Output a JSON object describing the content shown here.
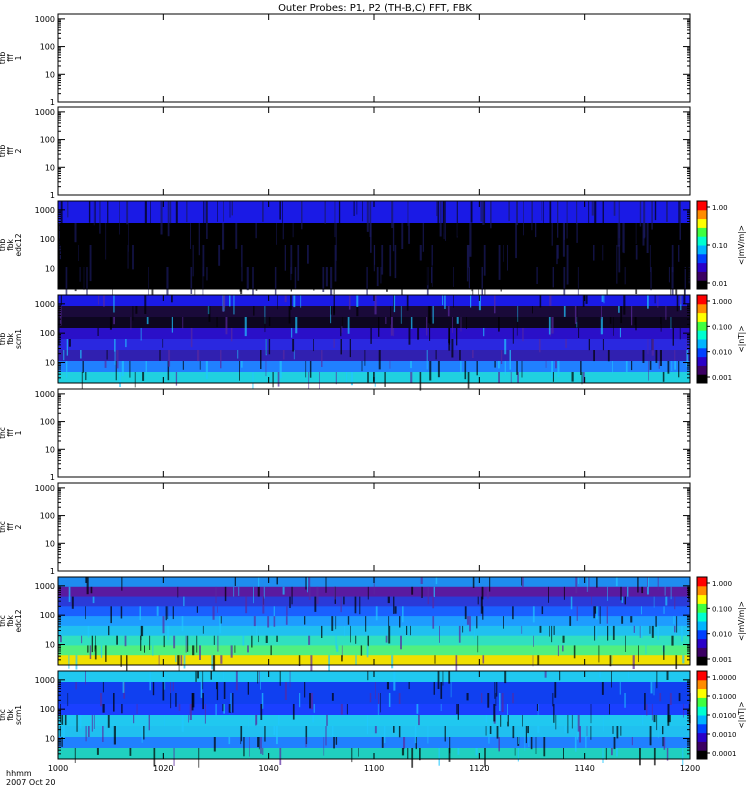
{
  "title": "Outer Probes: P1, P2 (TH-B,C) FFT, FBK",
  "time_axis": {
    "title_line1": "hhmm",
    "title_line2": "2007 Oct 20",
    "ticks": [
      "1000",
      "1020",
      "1040",
      "1100",
      "1120",
      "1140",
      "1200"
    ],
    "range": [
      "10:00",
      "12:00"
    ]
  },
  "colors": {
    "colorbar": [
      "#000000",
      "#3b0063",
      "#2a00c8",
      "#0040ff",
      "#00b4ff",
      "#00ffd0",
      "#40ff40",
      "#ffff00",
      "#ff8c00",
      "#ff0000"
    ]
  },
  "chart_data": [
    {
      "type": "heatmap",
      "ylabel": [
        "thb",
        "fff",
        "1"
      ],
      "y_ticks": [
        "1",
        "10",
        "100",
        "1000"
      ],
      "ylim": [
        1,
        1500
      ],
      "yscale": "log",
      "has_data": false
    },
    {
      "type": "heatmap",
      "ylabel": [
        "thb",
        "fff",
        "2"
      ],
      "y_ticks": [
        "1",
        "10",
        "100",
        "1000"
      ],
      "ylim": [
        1,
        1500
      ],
      "yscale": "log",
      "has_data": false
    },
    {
      "type": "heatmap",
      "ylabel": [
        "thb",
        "fbk",
        "edc12"
      ],
      "y_ticks": [
        "10",
        "100",
        "1000"
      ],
      "ylim": [
        2,
        2000
      ],
      "yscale": "log",
      "has_data": true,
      "bands": [
        "#1a1ae6",
        "#000000",
        "#000000",
        "#000000"
      ],
      "colorbar": {
        "label": "<|mV/m|>",
        "ticks": [
          "1.00",
          "0.10",
          "0.01"
        ]
      }
    },
    {
      "type": "heatmap",
      "ylabel": [
        "thb",
        "fbk",
        "scm1"
      ],
      "y_ticks": [
        "10",
        "100",
        "1000"
      ],
      "ylim": [
        2,
        2000
      ],
      "yscale": "log",
      "has_data": true,
      "bands": [
        "#1a1ae6",
        "#1a0a3a",
        "#0d0620",
        "#2a10c8",
        "#2a28e0",
        "#3020b0",
        "#2080ff",
        "#20d0e0"
      ],
      "colorbar": {
        "label": "<|nT|>",
        "ticks": [
          "1.000",
          "0.100",
          "0.010",
          "0.001"
        ]
      }
    },
    {
      "type": "heatmap",
      "ylabel": [
        "thc",
        "fff",
        "1"
      ],
      "y_ticks": [
        "1",
        "10",
        "100",
        "1000"
      ],
      "ylim": [
        1,
        1500
      ],
      "yscale": "log",
      "has_data": false
    },
    {
      "type": "heatmap",
      "ylabel": [
        "thc",
        "fff",
        "2"
      ],
      "y_ticks": [
        "1",
        "10",
        "100",
        "1000"
      ],
      "ylim": [
        1,
        1500
      ],
      "yscale": "log",
      "has_data": false
    },
    {
      "type": "heatmap",
      "ylabel": [
        "thc",
        "fbk",
        "edc12"
      ],
      "y_ticks": [
        "10",
        "100",
        "1000"
      ],
      "ylim": [
        2,
        2000
      ],
      "yscale": "log",
      "has_data": true,
      "bands": [
        "#1e8cf0",
        "#5a1aa0",
        "#2a3ad8",
        "#1a60ff",
        "#1e9cff",
        "#20c0f0",
        "#30e0c0",
        "#50f080",
        "#f0e000"
      ],
      "colorbar": {
        "label": "<|mV/m|>",
        "ticks": [
          "1.000",
          "0.100",
          "0.010",
          "0.001"
        ]
      }
    },
    {
      "type": "heatmap",
      "ylabel": [
        "thc",
        "fbk",
        "scm1"
      ],
      "y_ticks": [
        "10",
        "100",
        "1000"
      ],
      "ylim": [
        2,
        2000
      ],
      "yscale": "log",
      "has_data": true,
      "bands": [
        "#20c8f0",
        "#1040f0",
        "#1040f0",
        "#1a40ff",
        "#20c8f0",
        "#20c0f0",
        "#2080ff",
        "#20d0c0"
      ],
      "colorbar": {
        "label": "<|nT|>",
        "ticks": [
          "1.0000",
          "0.1000",
          "0.0100",
          "0.0010",
          "0.0001"
        ]
      }
    }
  ]
}
